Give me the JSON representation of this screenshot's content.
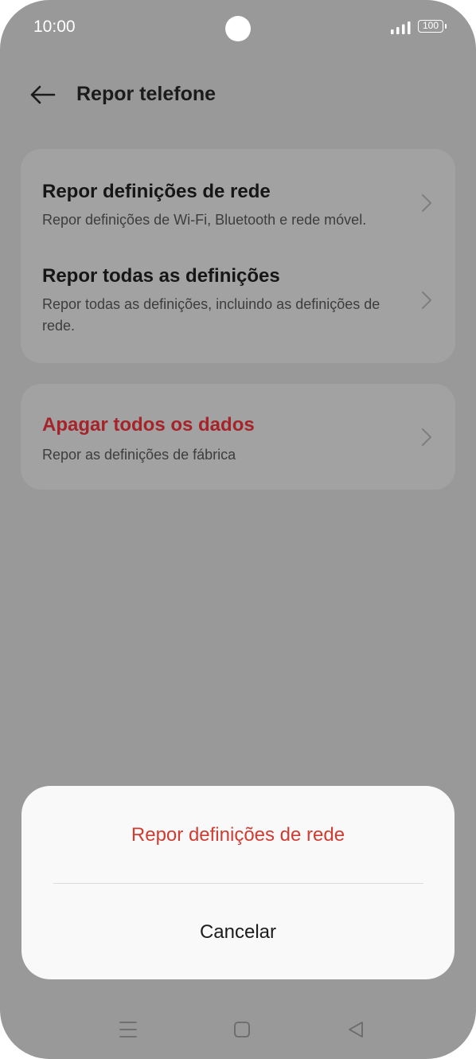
{
  "status_bar": {
    "time": "10:00",
    "battery": "100",
    "icons": [
      "camera-cutout",
      "signal-icon",
      "battery-icon"
    ]
  },
  "header": {
    "title": "Repor telefone",
    "back_icon": "arrow-left-icon"
  },
  "options": [
    {
      "title": "Repor definições de rede",
      "subtitle": "Repor definições de Wi-Fi, Bluetooth e rede móvel."
    },
    {
      "title": "Repor todas as definições",
      "subtitle": "Repor todas as definições, incluindo as definições de rede."
    },
    {
      "title": "Apagar todos os dados",
      "subtitle": "Repor as definições de fábrica"
    }
  ],
  "bottom_sheet": {
    "confirm_label": "Repor definições de rede",
    "cancel_label": "Cancelar"
  },
  "nav_bar": {
    "icons": [
      "menu-icon",
      "home-icon",
      "back-triangle-icon"
    ]
  },
  "colors": {
    "scrim": "#999999",
    "danger_text": "#a5242a",
    "sheet_action": "#cf3c31",
    "sheet_background": "#f9f9f9"
  }
}
